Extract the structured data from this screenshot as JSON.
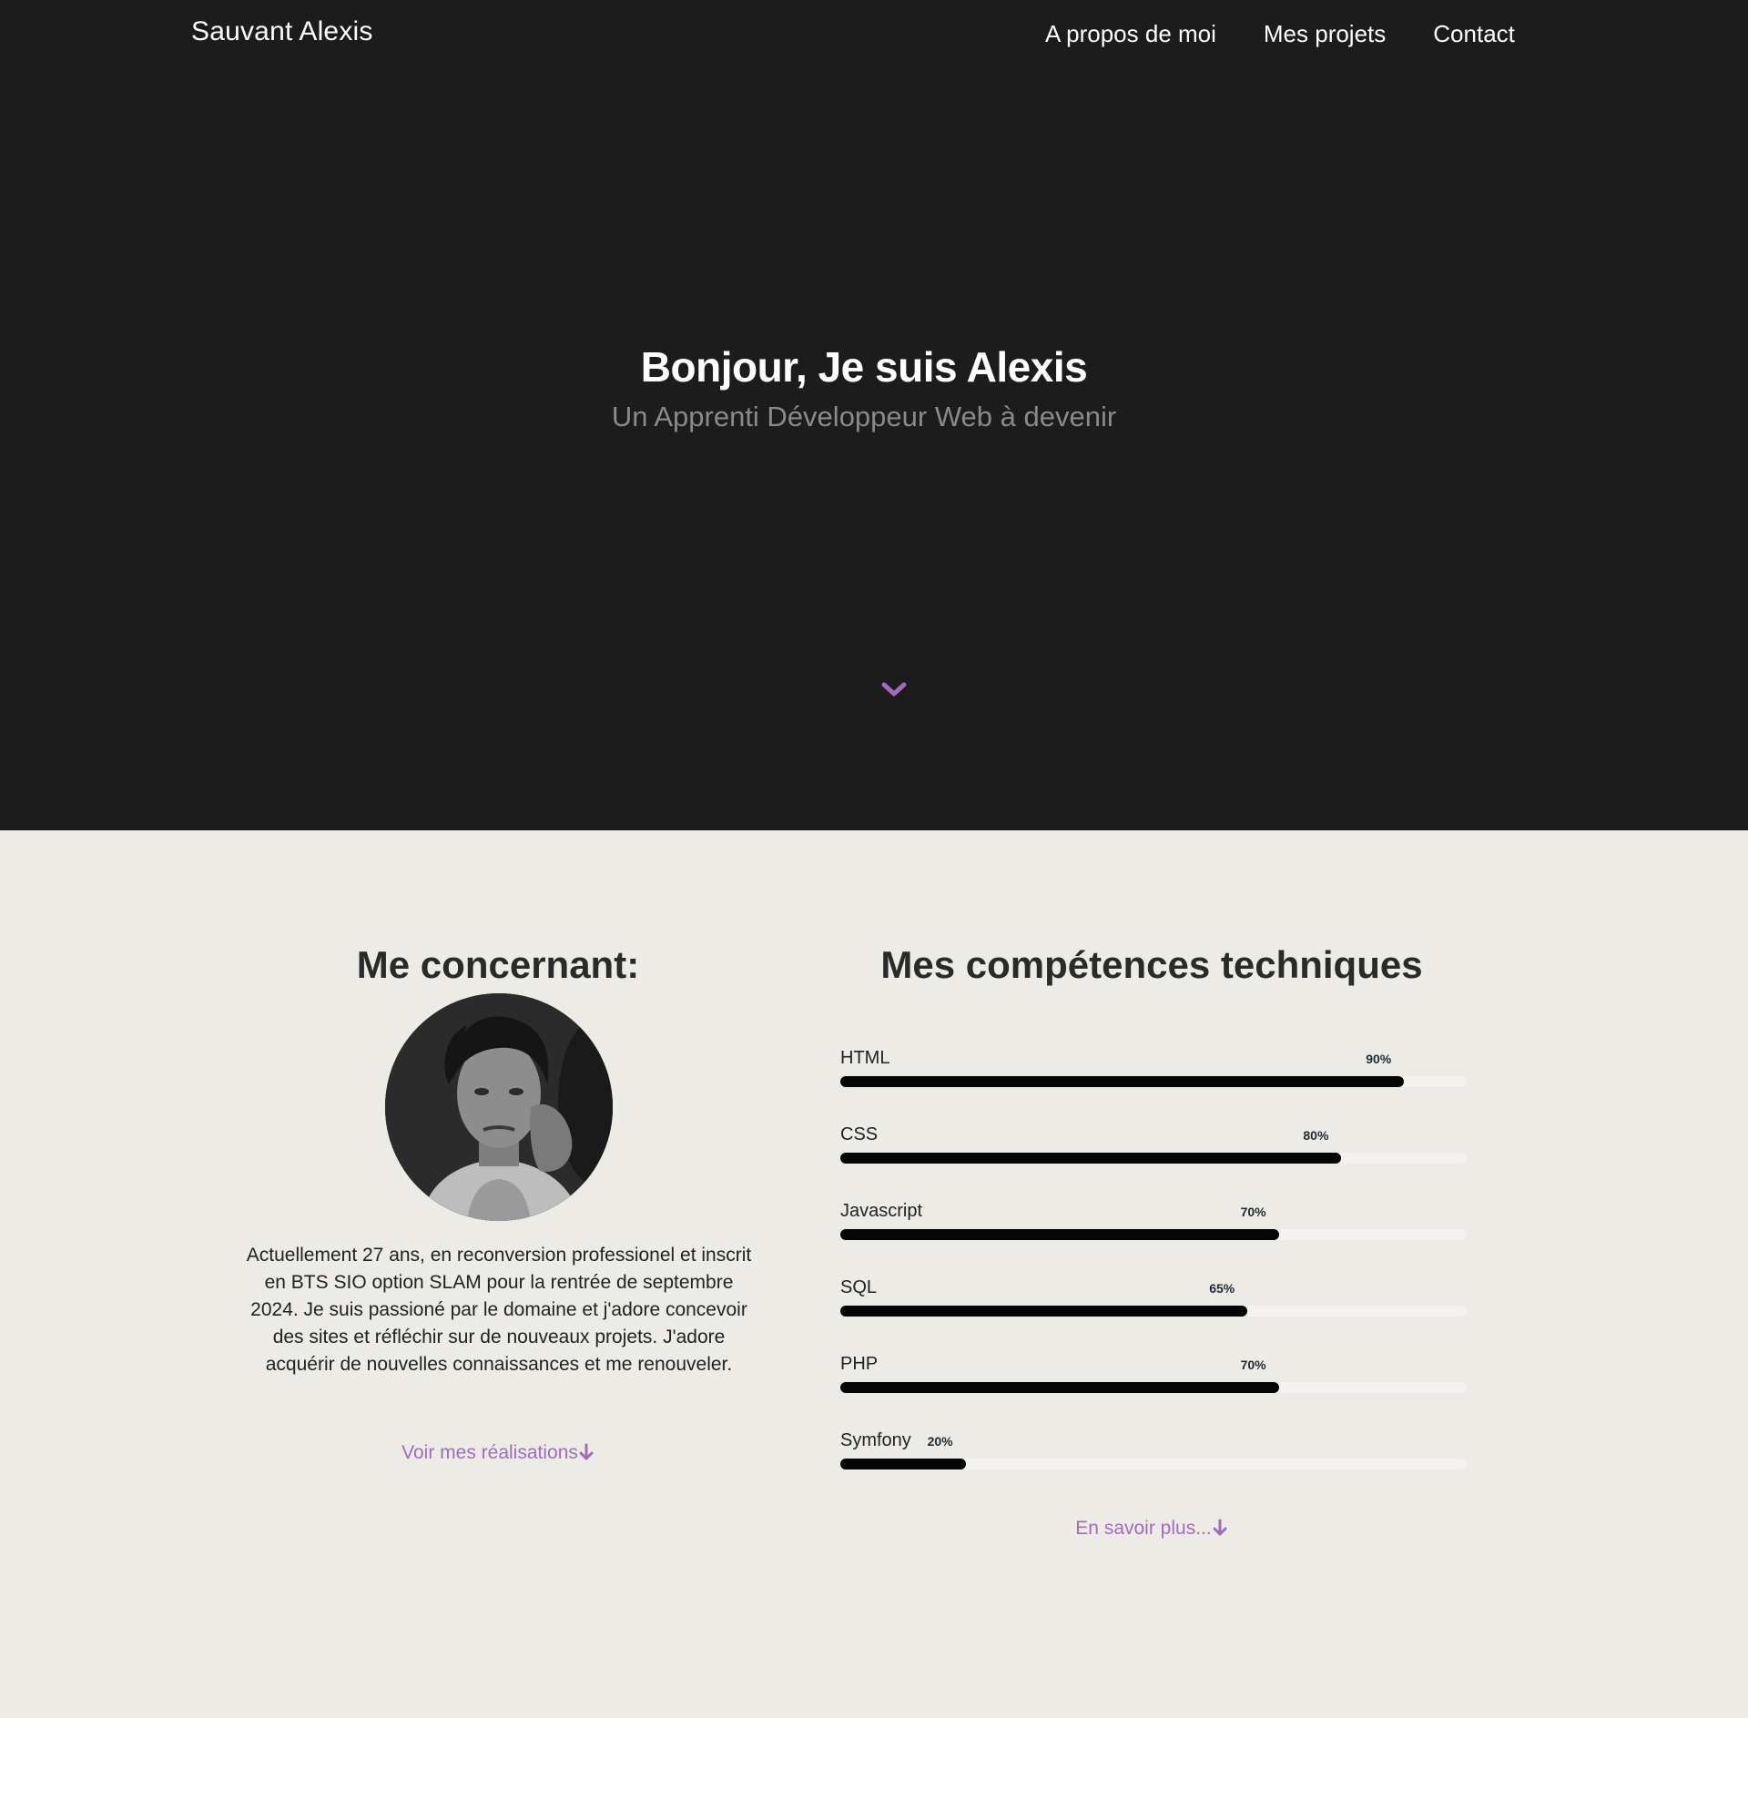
{
  "header": {
    "brand": "Sauvant Alexis",
    "nav": [
      "A propos de moi",
      "Mes projets",
      "Contact"
    ]
  },
  "hero": {
    "title": "Bonjour, Je suis Alexis",
    "subtitle": "Un Apprenti Développeur Web à devenir",
    "scroll_icon": "chevron-down-icon"
  },
  "about": {
    "title": "Me concernant:",
    "text": "Actuellement 27 ans, en reconversion professionel et inscrit en BTS SIO option SLAM pour la rentrée de septembre 2024. Je suis passioné par le domaine et j'adore concevoir des sites et réfléchir sur de nouveaux projets. J'adore acquérir de nouvelles connaissances et me renouveler.",
    "link": "Voir mes réalisations",
    "link_icon": "arrow-down-icon"
  },
  "skills": {
    "title": "Mes compétences techniques",
    "items": [
      {
        "name": "HTML",
        "percent": "90%"
      },
      {
        "name": "CSS",
        "percent": "80%"
      },
      {
        "name": "Javascript",
        "percent": "70%"
      },
      {
        "name": "SQL",
        "percent": "65%"
      },
      {
        "name": "PHP",
        "percent": "70%"
      },
      {
        "name": "Symfony",
        "percent": "20%"
      }
    ],
    "link": "En savoir plus...",
    "link_icon": "arrow-down-icon"
  },
  "colors": {
    "hero_bg": "#1c1c1c",
    "about_bg": "#ecebe5",
    "accent": "#a36bbf"
  }
}
